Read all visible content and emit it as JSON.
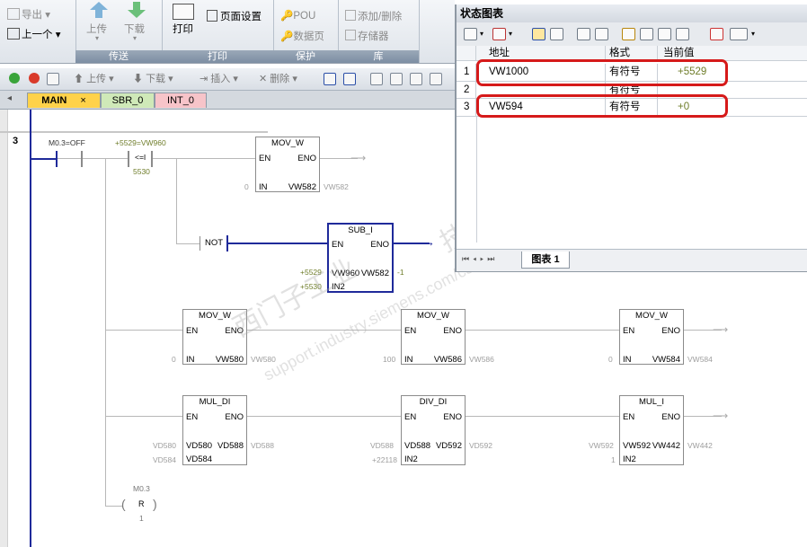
{
  "ribbon": {
    "export_label": "导出",
    "previous_label": "上一个",
    "upload_label": "上传",
    "download_label": "下载",
    "transfer_group": "传送",
    "print_label": "打印",
    "page_setup_label": "页面设置",
    "print_group": "打印",
    "pou_label": "POU",
    "datapage_label": "数据页",
    "protect_group": "保护",
    "add_delete_label": "添加/删除",
    "memory_label": "存储器",
    "library_group": "库"
  },
  "toolbar": {
    "upload": "上传",
    "download": "下载",
    "insert": "插入",
    "delete": "删除"
  },
  "tabs": [
    {
      "label": "MAIN",
      "close": "×"
    },
    {
      "label": "SBR_0"
    },
    {
      "label": "INT_0"
    }
  ],
  "ladder": {
    "network_number": "3",
    "contact1": "M0.3=OFF",
    "compare_label": "+5529=VW960",
    "compare_op": "<=I",
    "compare_ref": "5530",
    "mov1": {
      "title": "MOV_W",
      "en": "EN",
      "eno": "ENO",
      "in": "IN",
      "out": "VW582",
      "in_val": "0",
      "out_val": "VW582"
    },
    "not_label": "NOT",
    "sub": {
      "title": "SUB_I",
      "en": "EN",
      "eno": "ENO",
      "in1": "VW960",
      "in2": "IN2",
      "out": "VW582",
      "in1_val": "+5529",
      "in2_val": "+5530",
      "out_val": "-1"
    },
    "mov2": {
      "title": "MOV_W",
      "en": "EN",
      "eno": "ENO",
      "in": "IN",
      "out": "VW580",
      "in_val": "0",
      "out_val": "VW580"
    },
    "mov3": {
      "title": "MOV_W",
      "en": "EN",
      "eno": "ENO",
      "in": "IN",
      "out": "VW586",
      "in_val": "100",
      "out_val": "VW586"
    },
    "mov4": {
      "title": "MOV_W",
      "en": "EN",
      "eno": "ENO",
      "in": "IN",
      "out": "VW584",
      "in_val": "0",
      "out_val": "VW584"
    },
    "mul_di": {
      "title": "MUL_DI",
      "en": "EN",
      "eno": "ENO",
      "in1": "VD580",
      "in2": "VD584",
      "out": "VD588",
      "in1_val": "VD580",
      "in2_val": "VD584",
      "out_val": "VD588"
    },
    "div_di": {
      "title": "DIV_DI",
      "en": "EN",
      "eno": "ENO",
      "in1": "VD588",
      "in2": "IN2",
      "out": "VD592",
      "in1_val": "VD588",
      "in2_val": "+22118",
      "out_val": "VD592"
    },
    "mul_i": {
      "title": "MUL_I",
      "en": "EN",
      "eno": "ENO",
      "in1": "VW592",
      "in2": "IN2",
      "out": "VW442",
      "in1_val": "VW592",
      "in2_val": "1",
      "out_val": "VW442"
    },
    "reset_addr": "M0.3",
    "reset_op": "R",
    "reset_n": "1"
  },
  "status_chart": {
    "title": "状态图表",
    "headers": {
      "address": "地址",
      "format": "格式",
      "current": "当前值"
    },
    "rows": [
      {
        "n": "1",
        "address": "VW1000",
        "format": "有符号",
        "value": "+5529"
      },
      {
        "n": "2",
        "address": "",
        "format": "有符号",
        "value": ""
      },
      {
        "n": "3",
        "address": "VW594",
        "format": "有符号",
        "value": "+0"
      }
    ],
    "sheet_tab": "图表 1"
  },
  "watermark": {
    "line1": "西门子工业",
    "line2": "support.industry.siemens.com/cs",
    "line3": "技术论坛"
  },
  "colors": {
    "rail": "#1f2a9a",
    "highlight": "#d61a1a",
    "value_green": "#6f7d2a"
  }
}
